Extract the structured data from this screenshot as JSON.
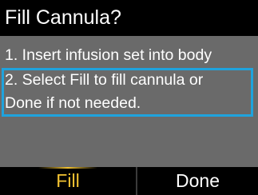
{
  "title": "Fill Cannula?",
  "steps": {
    "step1": "1. Insert infusion set into body",
    "step2_line1": "2. Select Fill to fill cannula or",
    "step2_line2": "Done if not needed."
  },
  "softkeys": {
    "left_label": "Fill",
    "right_label": "Done"
  },
  "colors": {
    "highlight": "#1fa3dd",
    "active_softkey": "#f2c232",
    "body_background": "#6a6a6a"
  }
}
